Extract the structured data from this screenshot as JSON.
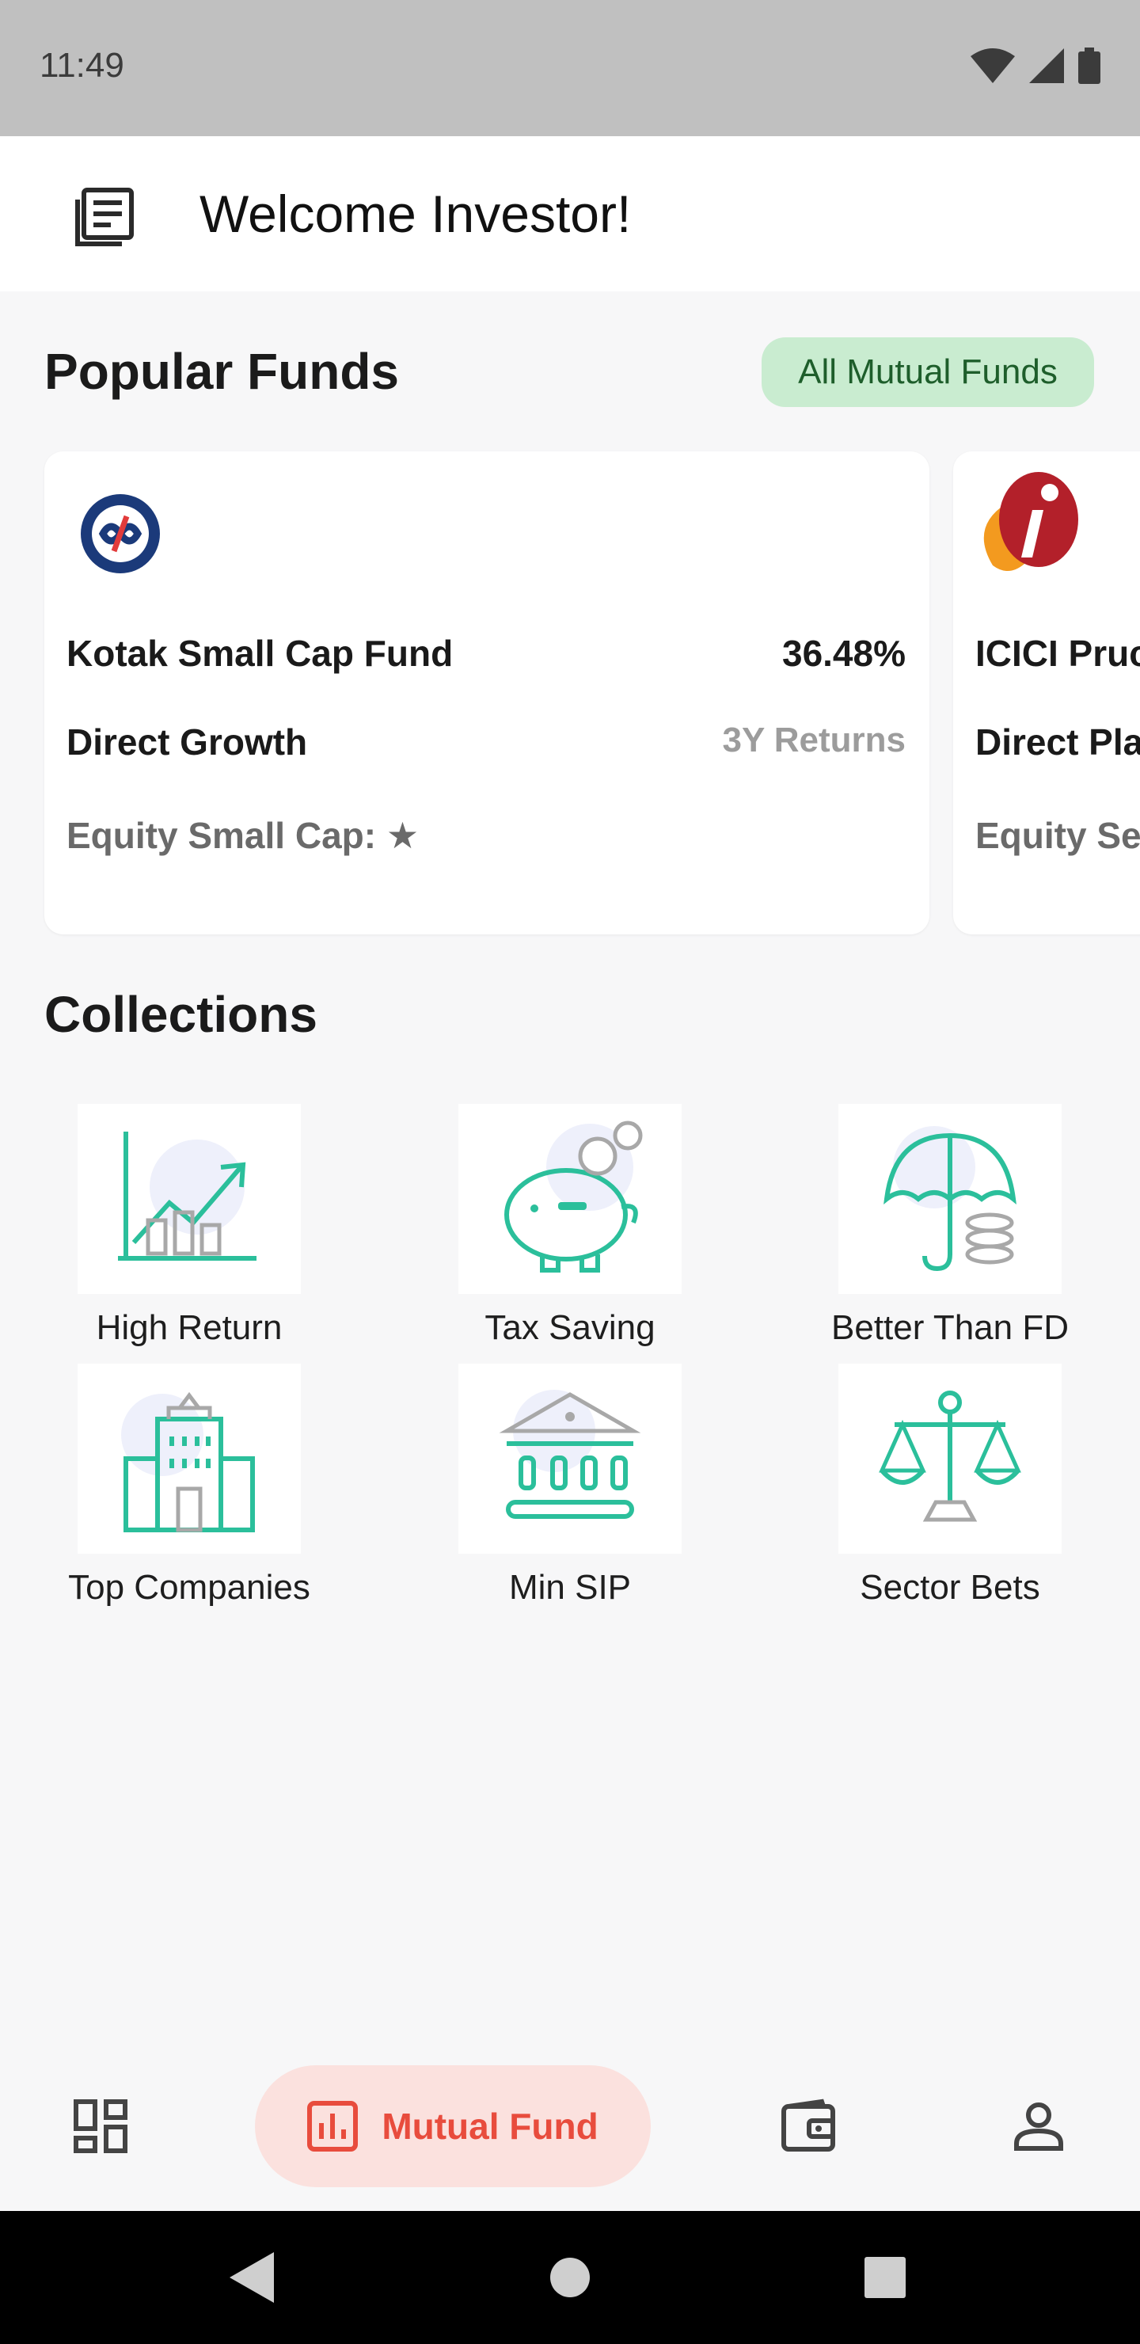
{
  "status_bar": {
    "time": "11:49"
  },
  "app_bar": {
    "title": "Welcome Investor!"
  },
  "popular": {
    "title": "Popular Funds",
    "all_button": "All Mutual Funds",
    "funds": [
      {
        "name": "Kotak Small Cap Fund",
        "return": "36.48%",
        "plan": "Direct Growth",
        "return_label": "3Y Returns",
        "category": "Equity Small Cap: ★"
      },
      {
        "name": "ICICI Pruc",
        "plan": "Direct Pla",
        "category": "Equity Se"
      }
    ]
  },
  "collections": {
    "title": "Collections",
    "items": [
      {
        "label": "High Return",
        "icon": "chart-growth-icon"
      },
      {
        "label": "Tax Saving",
        "icon": "piggy-bank-icon"
      },
      {
        "label": "Better Than FD",
        "icon": "umbrella-coins-icon"
      },
      {
        "label": "Top Companies",
        "icon": "office-building-icon"
      },
      {
        "label": "Min SIP",
        "icon": "bank-icon"
      },
      {
        "label": "Sector Bets",
        "icon": "scales-icon"
      }
    ]
  },
  "bottom_nav": {
    "items": [
      {
        "icon": "dashboard-icon"
      },
      {
        "icon": "bar-chart-icon",
        "label": "Mutual Fund",
        "active": true
      },
      {
        "icon": "wallet-icon"
      },
      {
        "icon": "person-icon"
      }
    ]
  },
  "colors": {
    "accent": "#e84c3d",
    "chip_bg": "#c9ecd0",
    "chip_text": "#1e5e2b",
    "teal": "#2bbf9b"
  }
}
